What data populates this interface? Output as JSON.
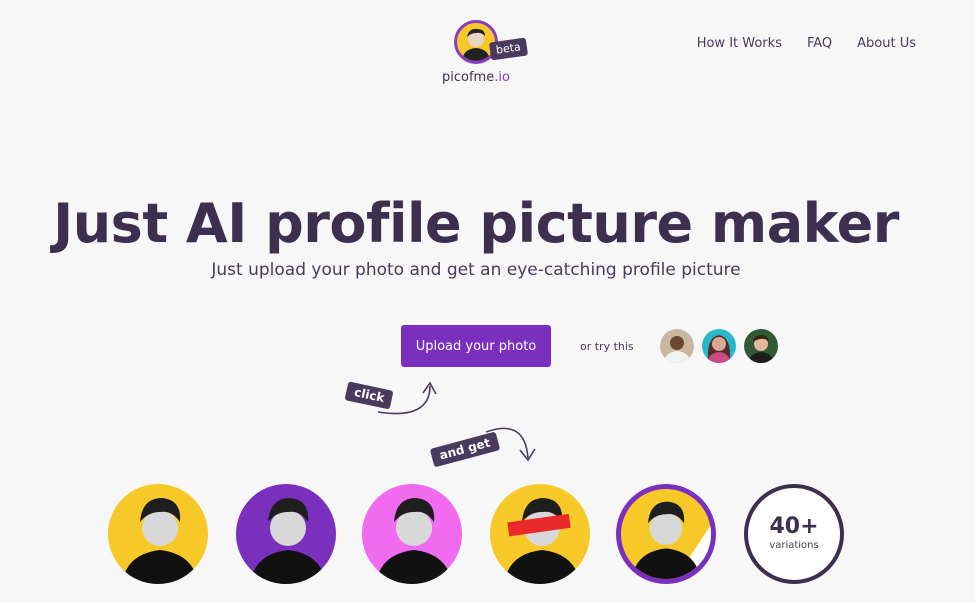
{
  "header": {
    "logo_name": "picofme",
    "logo_tld": ".io",
    "badge": "beta"
  },
  "nav": {
    "items": [
      {
        "label": "How It Works"
      },
      {
        "label": "FAQ"
      },
      {
        "label": "About Us"
      }
    ]
  },
  "hero": {
    "title": "Just AI profile picture maker",
    "subtitle": "Just upload your photo and get an eye-catching profile picture",
    "upload_label": "Upload your photo",
    "or_try": "or try this"
  },
  "annotations": {
    "click": "click",
    "and_get": "and get"
  },
  "results": {
    "variations_count": "40+",
    "variations_label": "variations",
    "backgrounds": [
      "#f6c928",
      "#7b2fbf",
      "#f06bf0",
      "#f6c928",
      "#f6c928"
    ]
  },
  "colors": {
    "accent": "#7b2fbf",
    "dark": "#3d2f4f",
    "yellow": "#f6c928",
    "pink": "#f06bf0"
  }
}
